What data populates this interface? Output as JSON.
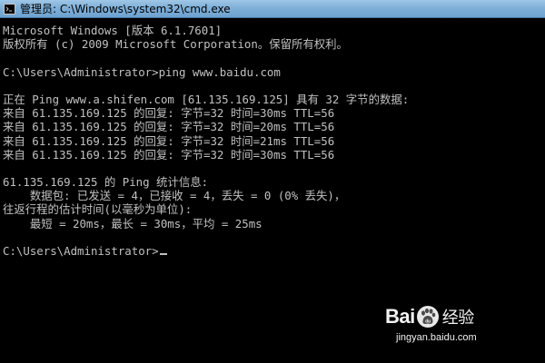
{
  "window": {
    "title": "管理员: C:\\Windows\\system32\\cmd.exe",
    "icon": "cmd-icon"
  },
  "terminal": {
    "lines": [
      "Microsoft Windows [版本 6.1.7601]",
      "版权所有 (c) 2009 Microsoft Corporation。保留所有权利。",
      "",
      "C:\\Users\\Administrator>ping www.baidu.com",
      "",
      "正在 Ping www.a.shifen.com [61.135.169.125] 具有 32 字节的数据:",
      "来自 61.135.169.125 的回复: 字节=32 时间=30ms TTL=56",
      "来自 61.135.169.125 的回复: 字节=32 时间=20ms TTL=56",
      "来自 61.135.169.125 的回复: 字节=32 时间=21ms TTL=56",
      "来自 61.135.169.125 的回复: 字节=32 时间=30ms TTL=56",
      "",
      "61.135.169.125 的 Ping 统计信息:",
      "    数据包: 已发送 = 4，已接收 = 4，丢失 = 0 (0% 丢失)，",
      "往返行程的估计时间(以毫秒为单位):",
      "    最短 = 20ms，最长 = 30ms，平均 = 25ms",
      "",
      "C:\\Users\\Administrator>"
    ],
    "text_color": "#c0c0c0",
    "background": "#000000"
  },
  "watermark": {
    "brand_prefix": "Bai",
    "brand_suffix": "经验",
    "url": "jingyan.baidu.com"
  }
}
